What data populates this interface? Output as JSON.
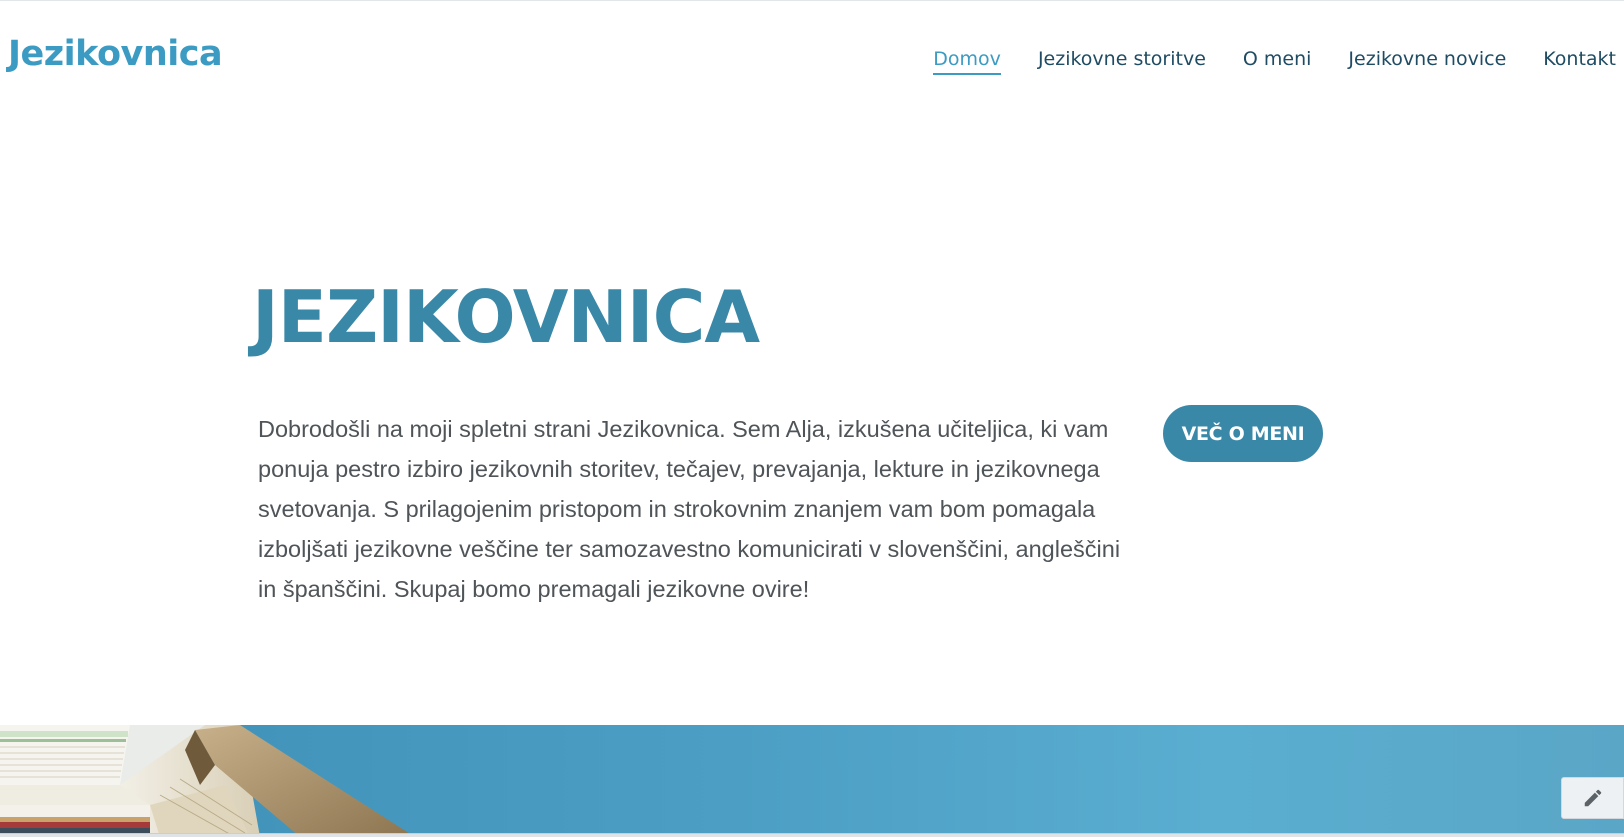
{
  "header": {
    "logo_text": "Jezikovnica",
    "nav": [
      {
        "label": "Domov",
        "active": true
      },
      {
        "label": "Jezikovne storitve",
        "active": false
      },
      {
        "label": "O meni",
        "active": false
      },
      {
        "label": "Jezikovne novice",
        "active": false
      },
      {
        "label": "Kontakt",
        "active": false
      }
    ]
  },
  "hero": {
    "title": "JEZIKOVNICA",
    "text": "Dobrodošli na moji spletni strani Jezikovnica. Sem Alja, izkušena učiteljica, ki vam ponuja pestro izbiro jezikovnih storitev, tečajev, prevajanja, lekture in jezikovnega svetovanja. S prilagojenim pristopom in strokovnim znanjem vam bom pomagala izboljšati jezikovne veščine ter samozavestno komunicirati v slovenščini, angleščini in španščini. Skupaj bomo premagali jezikovne ovire!",
    "button_label": "VEČ O MENI"
  },
  "banner": {
    "image_subject": "stacked-books-photo"
  },
  "edit_icon": "pencil-icon",
  "colors": {
    "brand": "#3b9bc3",
    "heading": "#3a88a8",
    "nav_text": "#1f4c63",
    "body_text": "#4f5458"
  }
}
